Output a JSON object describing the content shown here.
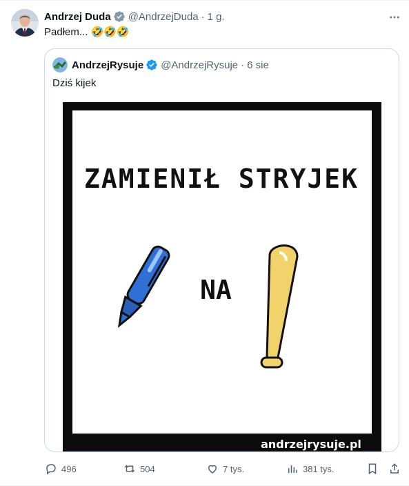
{
  "tweet": {
    "author_name": "Andrzej Duda",
    "author_handle": "@AndrzejDuda",
    "separator": "·",
    "time": "1 g.",
    "text": "Padłem...",
    "emojis": "🤣🤣🤣",
    "avatar_icon": "profile-photo"
  },
  "quote": {
    "author_name": "AndrzejRysuje",
    "author_handle": "@AndrzejRysuje",
    "separator": "·",
    "time": "6 sie",
    "text": "Dziś kijek",
    "image": {
      "caption_line": "ZAMIENIŁ STRYJEK",
      "middle_word": "NA",
      "watermark": "andrzejrysuje.pl",
      "pen_color": "#2f6fd6",
      "bat_color": "#f2d26b"
    }
  },
  "actions": {
    "replies": "496",
    "retweets": "504",
    "likes": "7 tys.",
    "views": "381 tys."
  },
  "colors": {
    "verified": "#1d9bf0",
    "muted": "#536471",
    "border": "#cfd9de"
  }
}
